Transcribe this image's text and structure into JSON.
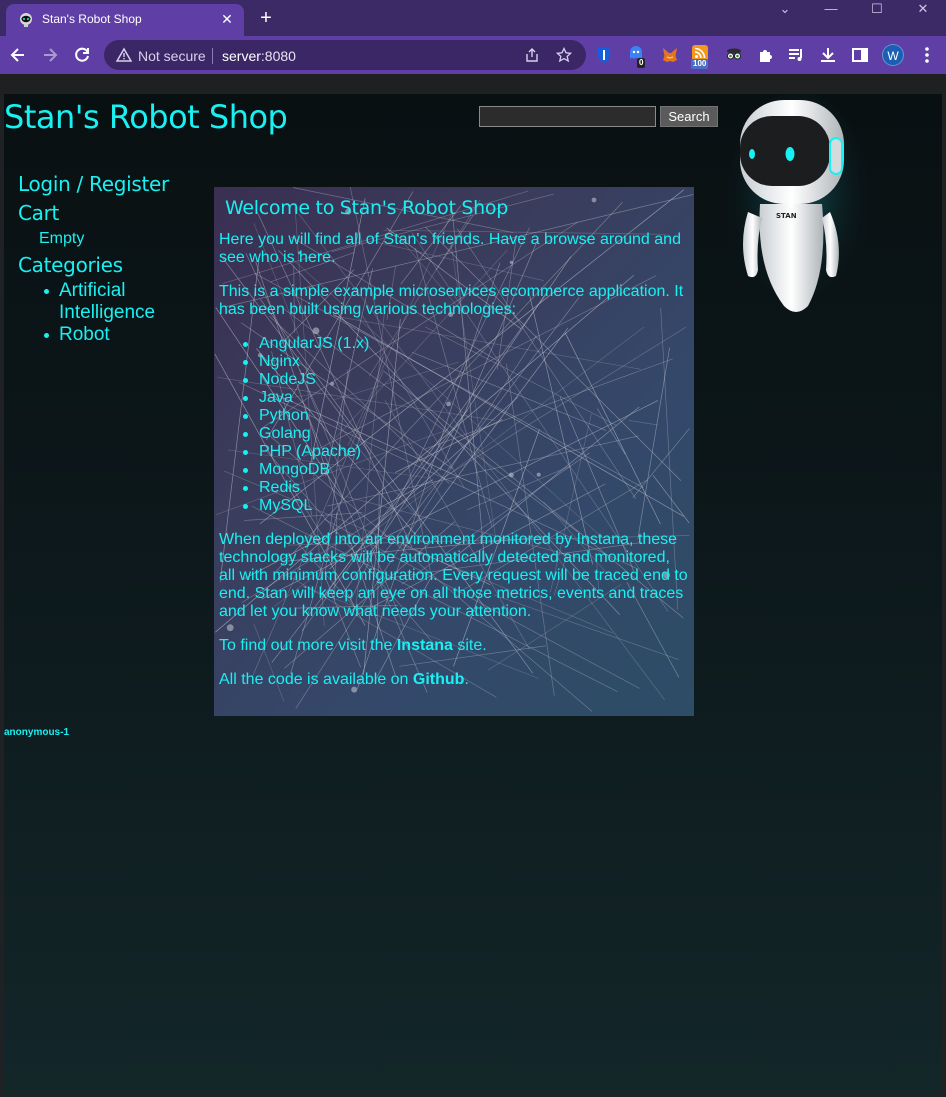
{
  "browser": {
    "tab_title": "Stan's Robot Shop",
    "new_tab": "+",
    "tab_close": "✕",
    "not_secure": "Not secure",
    "url_host": "server",
    "url_rest": ":8080",
    "profile_initial": "W",
    "ext_badges": {
      "notifications": "0",
      "rss": "100"
    },
    "colors": {
      "titlebar": "#3c2a66",
      "toolbar": "#5f3fa5"
    }
  },
  "site": {
    "title": "Stan's Robot Shop",
    "search_button": "Search",
    "search_value": "",
    "accent": "#19f0f2"
  },
  "sidebar": {
    "login": "Login / Register",
    "cart_heading": "Cart",
    "cart_status": "Empty",
    "categories_heading": "Categories",
    "categories": [
      "Artificial Intelligence",
      "Robot"
    ]
  },
  "main": {
    "welcome": "Welcome to Stan's Robot Shop",
    "intro": "Here you will find all of Stan's friends. Have a browse around and see who is here.",
    "about": "This is a simple example microservices ecommerce application. It has been built using various technologies:",
    "technologies": [
      "AngularJS (1.x)",
      "Nginx",
      "NodeJS",
      "Java",
      "Python",
      "Golang",
      "PHP (Apache)",
      "MongoDB",
      "Redis",
      "MySQL"
    ],
    "monitoring": "When deployed into an environment monitored by Instana, these technology stacks will be automatically detected and monitored, all with minimum configuration. Every request will be traced end to end. Stan will keep an eye on all those metrics, events and traces and let you know what needs your attention.",
    "instana_prefix": "To find out more visit the ",
    "instana_link": "Instana",
    "instana_suffix": " site.",
    "github_prefix": "All the code is available on ",
    "github_link": "Github",
    "github_suffix": "."
  },
  "footer": {
    "user": "anonymous-1"
  }
}
